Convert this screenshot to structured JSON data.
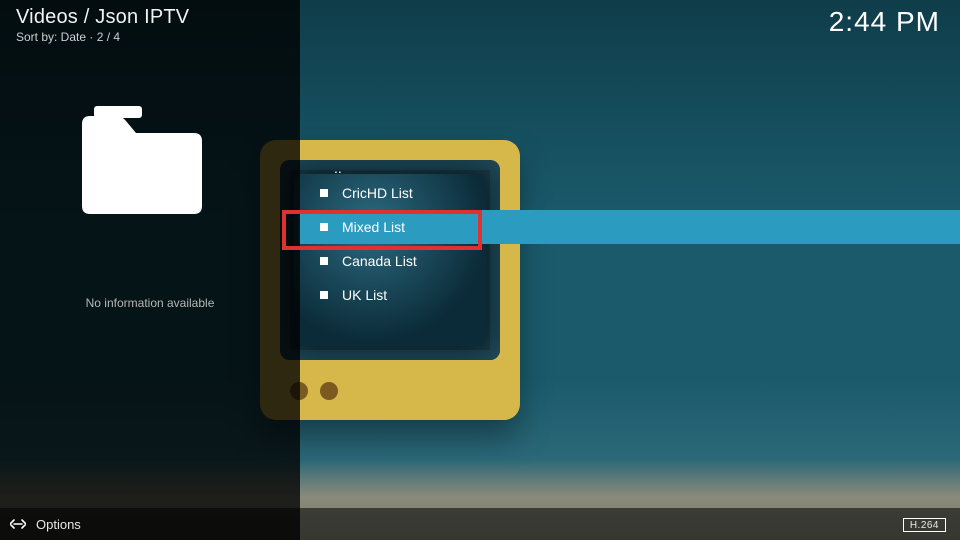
{
  "header": {
    "breadcrumb": "Videos / Json IPTV",
    "sort_line": "Sort by: Date  ·  2 / 4",
    "clock": "2:44 PM"
  },
  "sidebar": {
    "info_text": "No information available"
  },
  "list": {
    "parent_label": "..",
    "items": [
      {
        "label": "CricHD List",
        "selected": false
      },
      {
        "label": "Mixed List",
        "selected": true
      },
      {
        "label": "Canada List",
        "selected": false
      },
      {
        "label": "UK List",
        "selected": false
      }
    ]
  },
  "footer": {
    "options_label": "Options",
    "codec_badge": "H.264"
  }
}
